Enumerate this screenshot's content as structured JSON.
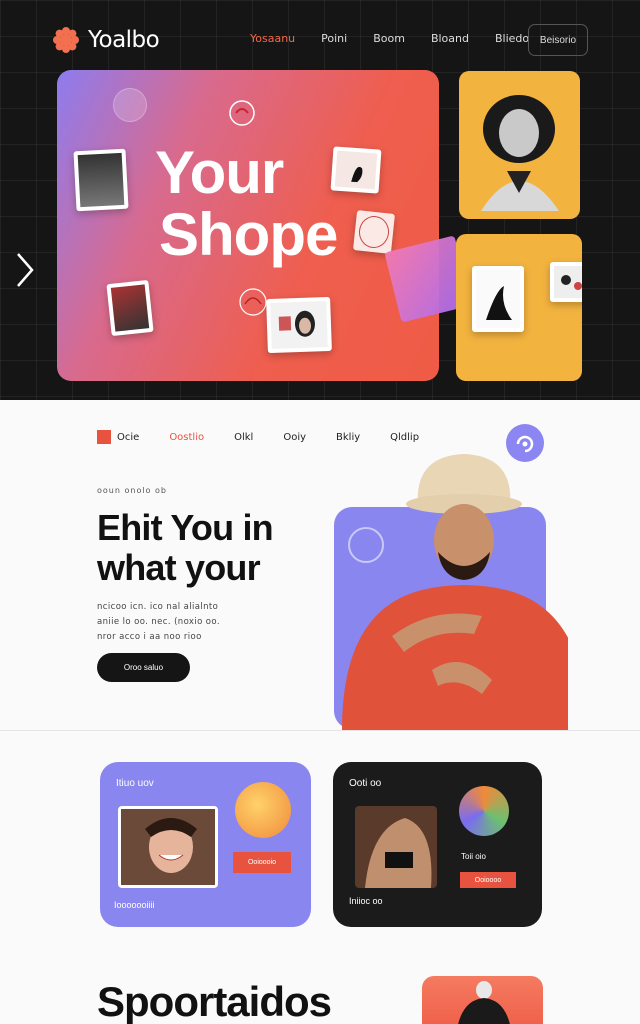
{
  "header": {
    "logo_text": "Yoalbo",
    "nav": [
      "Yosaanu",
      "Poini",
      "Boom",
      "Bloand",
      "Bliedo"
    ],
    "nav_button": "Beisorio"
  },
  "hero": {
    "title_line1": "Your",
    "title_line2": "Shope"
  },
  "section2": {
    "subnav": [
      "Ocie",
      "Oostlio",
      "Olkl",
      "Ooiy",
      "Bkliy",
      "Qldlip"
    ],
    "eyebrow": "ooun  onolo  ob",
    "headline_line1": "Ehit You in",
    "headline_line2": "what your",
    "paragraph_lines": [
      "ncicoo icn. ico nal alialnto",
      "aniie lo oo. nec. (noxio oo.",
      "nror acco i aa noo rioo"
    ],
    "cta_label": "Oroo saluo"
  },
  "section3": {
    "card1_title": "Itiuo  uov",
    "card1_button": "Ooioooio",
    "card1_footer": "Iooooooiiii",
    "card2_title": "Ooti oo",
    "card2_tag": "Toii oio",
    "card2_button": "Ooioooo",
    "card2_footer": "Iniioc oo"
  },
  "footer_section": {
    "big_title": "Spoortaidos"
  },
  "colors": {
    "accent": "#e8533f",
    "purple": "#8a86ef",
    "yellow": "#f3b33f",
    "dark": "#151515"
  }
}
